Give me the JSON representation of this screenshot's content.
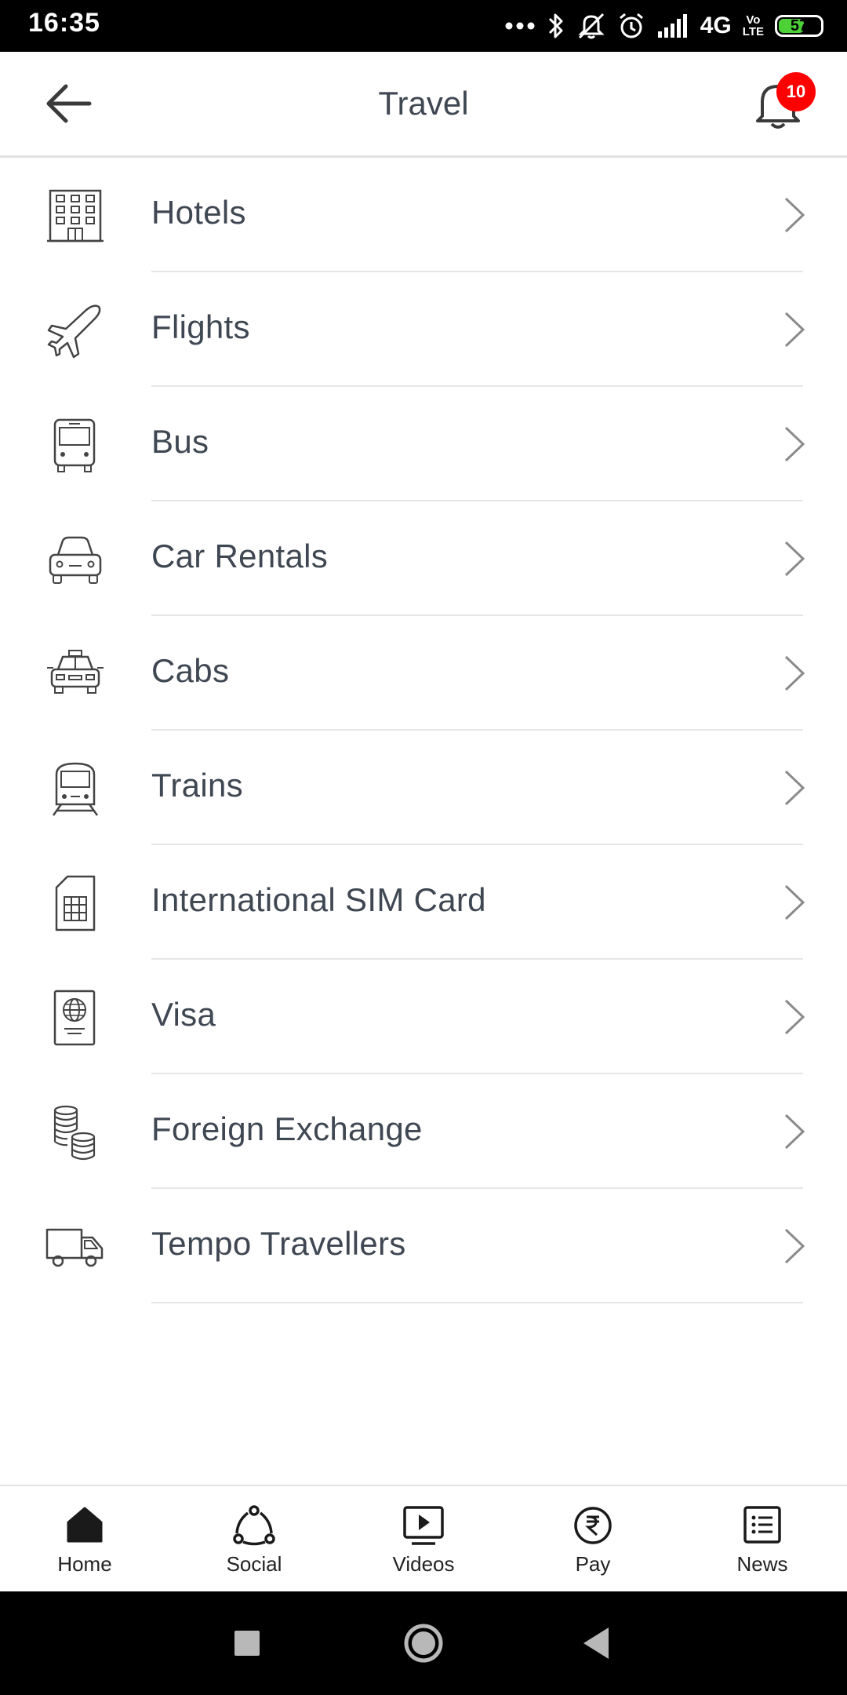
{
  "status_bar": {
    "time": "16:35",
    "network": "4G",
    "volte_top": "Vo",
    "volte_bottom": "LTE",
    "battery": "57",
    "icons": [
      "more-dots-icon",
      "bluetooth-icon",
      "mute-icon",
      "alarm-icon",
      "signal-icon",
      "battery-icon"
    ]
  },
  "header": {
    "title": "Travel",
    "notification_count": "10",
    "back_icon": "arrow-left-icon",
    "bell_icon": "bell-icon",
    "badge_color": "#ff0000"
  },
  "menu": {
    "items": [
      {
        "label": "Hotels",
        "icon": "hotel-building-icon"
      },
      {
        "label": "Flights",
        "icon": "airplane-icon"
      },
      {
        "label": "Bus",
        "icon": "bus-icon"
      },
      {
        "label": "Car Rentals",
        "icon": "car-icon"
      },
      {
        "label": "Cabs",
        "icon": "taxi-icon"
      },
      {
        "label": "Trains",
        "icon": "train-icon"
      },
      {
        "label": "International SIM Card",
        "icon": "sim-card-icon"
      },
      {
        "label": "Visa",
        "icon": "passport-icon"
      },
      {
        "label": "Foreign Exchange",
        "icon": "coins-icon"
      },
      {
        "label": "Tempo Travellers",
        "icon": "van-icon"
      }
    ]
  },
  "bottom_nav": {
    "items": [
      {
        "label": "Home",
        "icon": "home-icon"
      },
      {
        "label": "Social",
        "icon": "social-share-icon"
      },
      {
        "label": "Videos",
        "icon": "video-play-icon"
      },
      {
        "label": "Pay",
        "icon": "rupee-icon"
      },
      {
        "label": "News",
        "icon": "news-list-icon"
      }
    ]
  }
}
